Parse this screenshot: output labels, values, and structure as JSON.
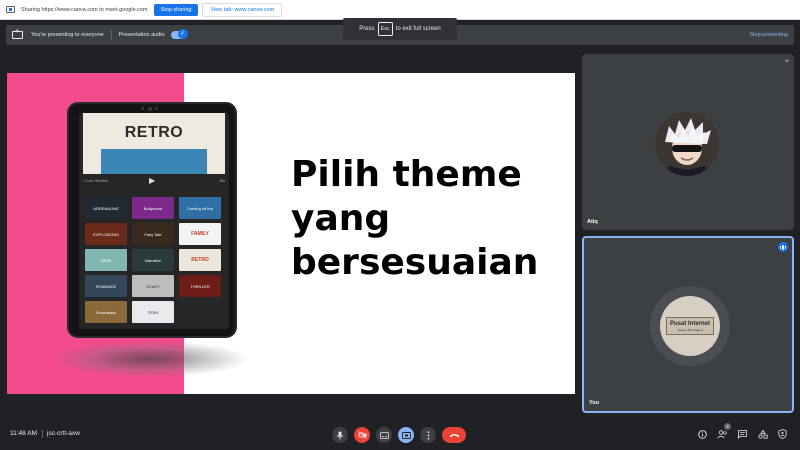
{
  "share_bar": {
    "sharing_text": "Sharing https://www.canva.com to meet.google.com",
    "stop_sharing_label": "Stop sharing",
    "view_tab_label": "View tab: www.canva.com"
  },
  "present_bar": {
    "presenting_text": "You're presenting to everyone",
    "audio_label": "Presentation audio",
    "audio_enabled": true,
    "stop_presenting_label": "Stop presenting"
  },
  "esc_toast": {
    "prefix": "Press",
    "key": "Esc",
    "suffix": "to exit full screen"
  },
  "slide": {
    "heading_lines": [
      "Pilih theme",
      "yang",
      "bersesuaian"
    ],
    "accent_color": "#f44b8f",
    "tablet": {
      "hero_title": "RETRO",
      "meta_left": "1 Cont. Member",
      "meta_right": "38s",
      "themes": [
        {
          "label": "ADRENALINE",
          "bg": "#1f2a34"
        },
        {
          "label": "Bollywood",
          "bg": "#7b2a8c"
        },
        {
          "label": "Coming off the",
          "bg": "#2f6fa6"
        },
        {
          "label": "EXPLOSIONS",
          "bg": "#6a2a1a"
        },
        {
          "label": "Fairy Tale",
          "bg": "#3a2a1e"
        },
        {
          "label": "FAMILY",
          "bg": "#f4f4f4"
        },
        {
          "label": "INDIE",
          "bg": "#7fb7b0"
        },
        {
          "label": "Narrative",
          "bg": "#2b3a3a"
        },
        {
          "label": "RETRO",
          "bg": "#ede6da"
        },
        {
          "label": "ROMANCE",
          "bg": "#34465a"
        },
        {
          "label": "SCARY",
          "bg": "#bdbdbd"
        },
        {
          "label": "THRILLER",
          "bg": "#6e1c16"
        },
        {
          "label": "Soundtrack",
          "bg": "#8a6a3a"
        },
        {
          "label": "TEEN",
          "bg": "#e9e9ee"
        }
      ]
    }
  },
  "participants": {
    "atiq": {
      "name": "Atiq"
    },
    "you": {
      "name": "You",
      "avatar_sign": "Pusat Internet",
      "avatar_sign_sub": "Taman Jitra Pagoh"
    }
  },
  "bottom_bar": {
    "time": "11:48 AM",
    "meeting_code": "jsc-crtt-axw",
    "participants_count": "3",
    "controls": {
      "mic": "mic-icon",
      "camera_off": "camera-off-icon",
      "captions": "captions-icon",
      "present": "present-icon",
      "more": "more-options-icon",
      "hangup": "hangup-icon"
    }
  },
  "colors": {
    "meet_background": "#202124",
    "tile_background": "#3c4043",
    "accent_blue": "#8ab4f8",
    "button_blue": "#1a73e8",
    "hangup_red": "#ea4335"
  }
}
